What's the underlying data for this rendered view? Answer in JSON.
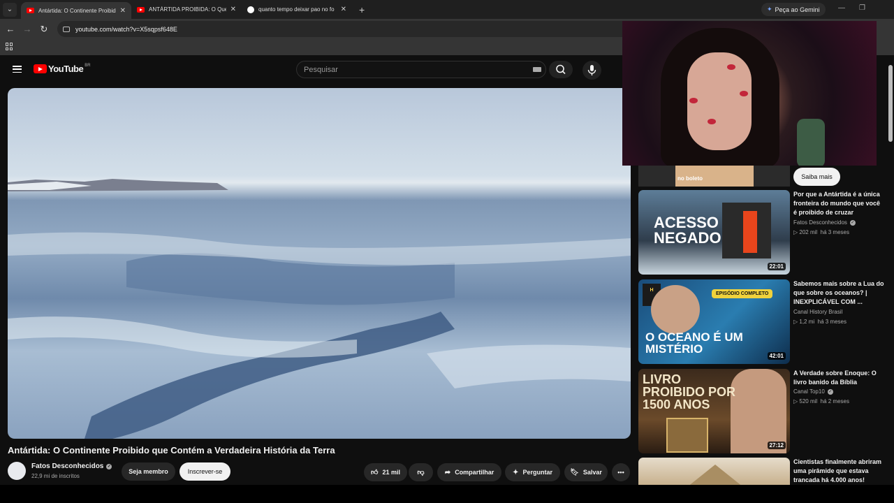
{
  "browser": {
    "tabs": [
      {
        "title": "Antártida: O Continente Proibid",
        "icon": "youtube-icon",
        "active": true
      },
      {
        "title": "ANTÁRTIDA PROIBIDA: O Que e",
        "icon": "youtube-icon",
        "active": false
      },
      {
        "title": "quanto tempo deixar pao no fo",
        "icon": "google-icon",
        "active": false
      }
    ],
    "gemini_label": "Peça ao Gemini",
    "url": "youtube.com/watch?v=X5sqpsf648E"
  },
  "youtube": {
    "logo_text": "YouTube",
    "country_code": "BR",
    "search_placeholder": "Pesquisar"
  },
  "video": {
    "title": "Antártida: O Continente Proibido que Contém a Verdadeira História da Terra",
    "channel": "Fatos Desconhecidos",
    "subscribers": "22,9 mi de inscritos",
    "member_label": "Seja membro",
    "subscribe_label": "Inscrever-se",
    "likes": "21 mil",
    "share_label": "Compartilhar",
    "ask_label": "Perguntar",
    "save_label": "Salvar"
  },
  "ad": {
    "thumb_text": "no boleto",
    "cta": "Saiba mais"
  },
  "recommendations": [
    {
      "title": "Por que a Antártida é a única fronteira do mundo que você é proibido de cruzar",
      "channel": "Fatos Desconhecidos",
      "views": "202 mil",
      "age": "há 3 meses",
      "duration": "22:01",
      "thumb_text": "ACESSO NEGADO"
    },
    {
      "title": "Sabemos mais sobre a Lua do que sobre os oceanos? | INEXPLICÁVEL COM ...",
      "channel": "Canal History Brasil",
      "views": "1,2 mi",
      "age": "há 3 meses",
      "duration": "42:01",
      "thumb_text": "O OCEANO É UM MISTÉRIO",
      "thumb_badge": "EPISÓDIO COMPLETO"
    },
    {
      "title": "A Verdade sobre Enoque: O livro banido da Bíblia",
      "channel": "Canal Top10",
      "views": "520 mil",
      "age": "há 2 meses",
      "duration": "27:12",
      "thumb_text": "LIVRO PROIBIDO POR 1500 ANOS"
    },
    {
      "title": "Cientistas finalmente abriram uma pirâmide que estava trancada há 4.000 anos!",
      "channel": "",
      "views": "",
      "age": "",
      "duration": "",
      "thumb_text": ""
    }
  ]
}
